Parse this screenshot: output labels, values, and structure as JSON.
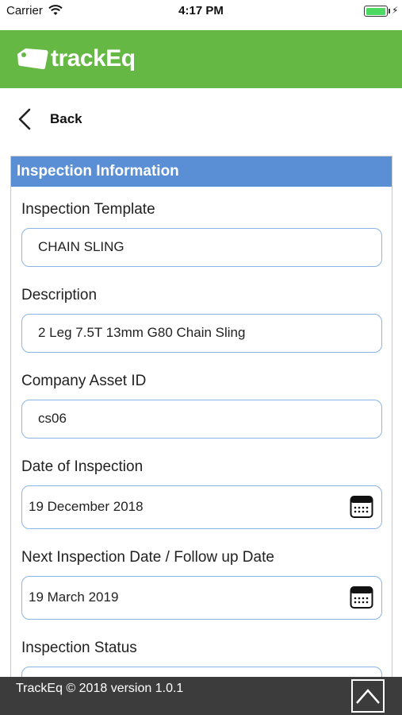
{
  "status_bar": {
    "carrier": "Carrier",
    "time": "4:17 PM",
    "battery_level": 1.0
  },
  "header": {
    "app_name": "trackEq",
    "brand_color": "#65b844"
  },
  "nav": {
    "back_label": "Back"
  },
  "section": {
    "title": "Inspection Information",
    "header_color": "#5a8fd6"
  },
  "fields": {
    "template": {
      "label": "Inspection Template",
      "value": "CHAIN SLING"
    },
    "description": {
      "label": "Description",
      "value": "2 Leg 7.5T 13mm G80 Chain Sling"
    },
    "asset_id": {
      "label": "Company Asset ID",
      "value": "cs06"
    },
    "inspection_date": {
      "label": "Date of Inspection",
      "value": "19 December 2018",
      "icon": "calendar-icon"
    },
    "next_date": {
      "label": "Next Inspection Date / Follow up Date",
      "value": "19 March 2019",
      "icon": "calendar-icon"
    },
    "status": {
      "label": "Inspection Status",
      "value": ""
    }
  },
  "footer": {
    "text": "TrackEq © 2018 version 1.0.1",
    "scroll_top_icon": "chevron-up-icon"
  }
}
